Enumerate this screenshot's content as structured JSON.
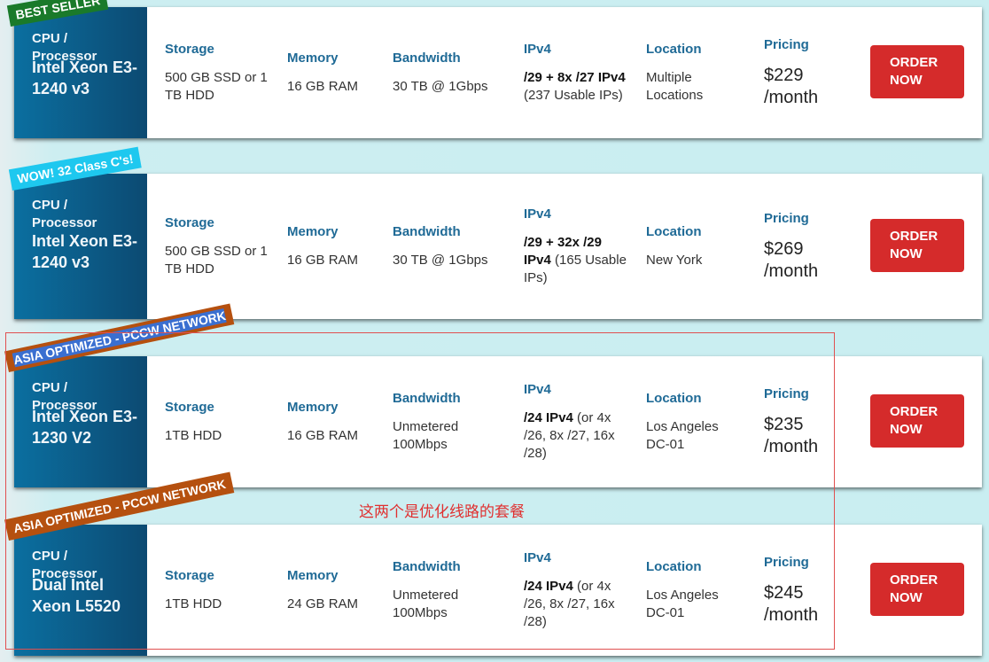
{
  "labels": {
    "cpu": "CPU /\nProcessor",
    "storage": "Storage",
    "memory": "Memory",
    "bandwidth": "Bandwidth",
    "ipv4": "IPv4",
    "location": "Location",
    "pricing": "Pricing",
    "order": "ORDER NOW"
  },
  "colors": {
    "button": "#d52b2b",
    "header": "#1f6a96",
    "best_seller": "#1a7a2a",
    "wow": "#1ec8ef",
    "asia": "#b5500f",
    "annotation": "#e03030"
  },
  "plans": [
    {
      "ribbon": "BEST SELLER",
      "cpu": "Intel Xeon E3-1240 v3",
      "storage": "500 GB SSD or 1 TB HDD",
      "memory": "16 GB RAM",
      "bandwidth": "30 TB @ 1Gbps",
      "ipv4_bold": "/29 + 8x /27 IPv4",
      "ipv4_rest": " (237 Usable IPs)",
      "location": "Multiple Locations",
      "price": "$229",
      "period": "/month"
    },
    {
      "ribbon": "WOW! 32 Class C's!",
      "cpu": "Intel Xeon E3-1240 v3",
      "storage": "500 GB SSD or 1 TB HDD",
      "memory": "16 GB RAM",
      "bandwidth": "30 TB @ 1Gbps",
      "ipv4_bold": "/29 + 32x /29 IPv4",
      "ipv4_rest": " (165 Usable IPs)",
      "location": "New York",
      "price": "$269",
      "period": "/month"
    },
    {
      "ribbon": "ASIA OPTIMIZED - PCCW NETWORK",
      "cpu": "Intel Xeon E3-1230 V2",
      "storage": "1TB HDD",
      "memory": "16 GB RAM",
      "bandwidth": "Unmetered 100Mbps",
      "ipv4_bold": "/24 IPv4",
      "ipv4_rest": " (or 4x /26, 8x /27, 16x /28)",
      "location": "Los Angeles DC-01",
      "price": "$235",
      "period": "/month"
    },
    {
      "ribbon": "ASIA OPTIMIZED - PCCW NETWORK",
      "cpu": "Dual Intel Xeon L5520",
      "storage": "1TB HDD",
      "memory": "24 GB RAM",
      "bandwidth": "Unmetered 100Mbps",
      "ipv4_bold": "/24 IPv4",
      "ipv4_rest": " (or 4x /26, 8x /27, 16x /28)",
      "location": "Los Angeles DC-01",
      "price": "$245",
      "period": "/month"
    }
  ],
  "annotation": "这两个是优化线路的套餐"
}
